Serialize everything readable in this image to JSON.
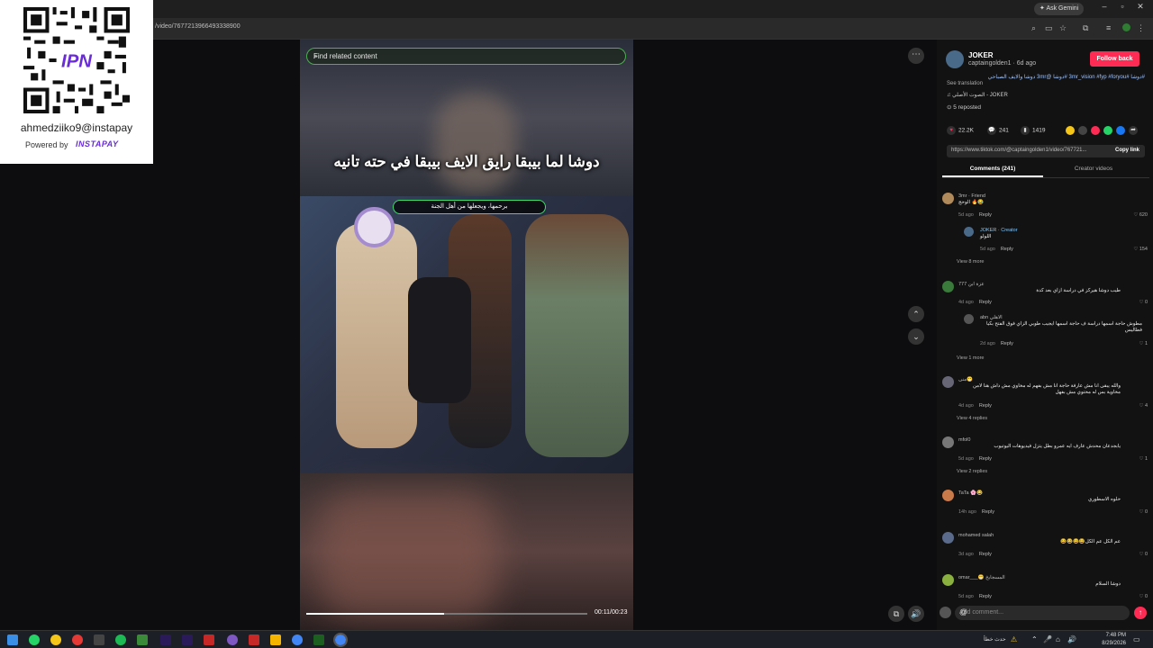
{
  "browser": {
    "url": "/video/7677213966493338900",
    "ask_gemini": "Ask Gemini",
    "window_controls": [
      "minimize-icon",
      "restore-icon",
      "close-icon"
    ]
  },
  "qr_overlay": {
    "handle": "ahmedziiko9@instapay",
    "powered_by": "Powered by",
    "brand": "INSTAPAY"
  },
  "video": {
    "search_placeholder": "Find related content",
    "caption": "دوشا لما بيبقا رايق الايف بيبقا في حته تانيه",
    "sub_caption": "برحمها، ويجعلها من أهل الجنة",
    "time": "00:11/00:23",
    "progress": 0.49
  },
  "post": {
    "author": "JOKER",
    "handle_line": "captaingolden1 · 6d ago",
    "follow_label": "Follow back",
    "description": "#دوشا #3mr_vision #fyp #foryou #دوشا @3mr دوشا والايف الصباحي",
    "see_translation": "See translation",
    "music": "الصوت الأصلي - JOKER",
    "reposted": "5 reposted",
    "likes": "22.2K",
    "comments": "241",
    "saves": "1419",
    "link": "https://www.tiktok.com/@captaingolden1/video/767721...",
    "copy_link": "Copy link",
    "tab_comments": "Comments (241)",
    "tab_creator": "Creator videos"
  },
  "comments": [
    {
      "name": "3mr · Friend",
      "text": "الوحج 🔥😂",
      "meta": "5d ago",
      "reply": "Reply",
      "likes": "620",
      "color": "#b08a5a"
    },
    {
      "name": "JOKER · Creator",
      "text": "اللولو",
      "meta": "5d ago",
      "reply": "Reply",
      "likes": "154",
      "color": "#4a6a8a"
    },
    {
      "name": "عزة ابن 777",
      "text": "طيب دوشا هيركز في دراسة ازاي بعد كدة",
      "meta": "4d ago",
      "reply": "Reply",
      "likes": "0",
      "color": "#3a7a3a"
    },
    {
      "name": "abn الاهلي",
      "text": "مطوش حاجة اسمها دراسة ف حاجة اسمها ايجيب طوبي الزاي فوق الفتح بكيا فطاليس",
      "meta": "2d ago",
      "reply": "Reply",
      "likes": "1",
      "color": "#555"
    },
    {
      "name": "منى😁",
      "text": "والله يبقى انا مش عارفة حاجة انا مش بفهم له مخاوي مش داش هنا لامن مخاوية بس له محتوي مش بفهل",
      "meta": "4d ago",
      "reply": "Reply",
      "likes": "4",
      "color": "#667"
    },
    {
      "name": "mfol0",
      "text": "يابجدعان محدش عارف ايه عمرو بطل يتزل فيديوهات اليوتيوب",
      "meta": "5d ago",
      "reply": "Reply",
      "likes": "1",
      "color": "#777"
    },
    {
      "name": "TaTa 🌸😂",
      "text": "حلوه الاسطوري",
      "meta": "14h ago",
      "reply": "Reply",
      "likes": "0",
      "color": "#c87a4a"
    },
    {
      "name": "mohamed salah",
      "text": "عم الكل عم الكل😂😂😂😂",
      "meta": "3d ago",
      "reply": "Reply",
      "likes": "0",
      "color": "#5a6a8a"
    },
    {
      "name": "omar___😁 المسجايخ",
      "text": "دوشا السلام",
      "meta": "5d ago",
      "reply": "Reply",
      "likes": "0",
      "color": "#8ab040"
    }
  ],
  "view_more": [
    "View 8 more",
    "View 1 more",
    "View 4 replies",
    "View 2 replies"
  ],
  "add_comment": "Add comment...",
  "tray": {
    "weather": "حدث خطأ",
    "time": "7:48 PM",
    "date": "8/29/2026"
  }
}
